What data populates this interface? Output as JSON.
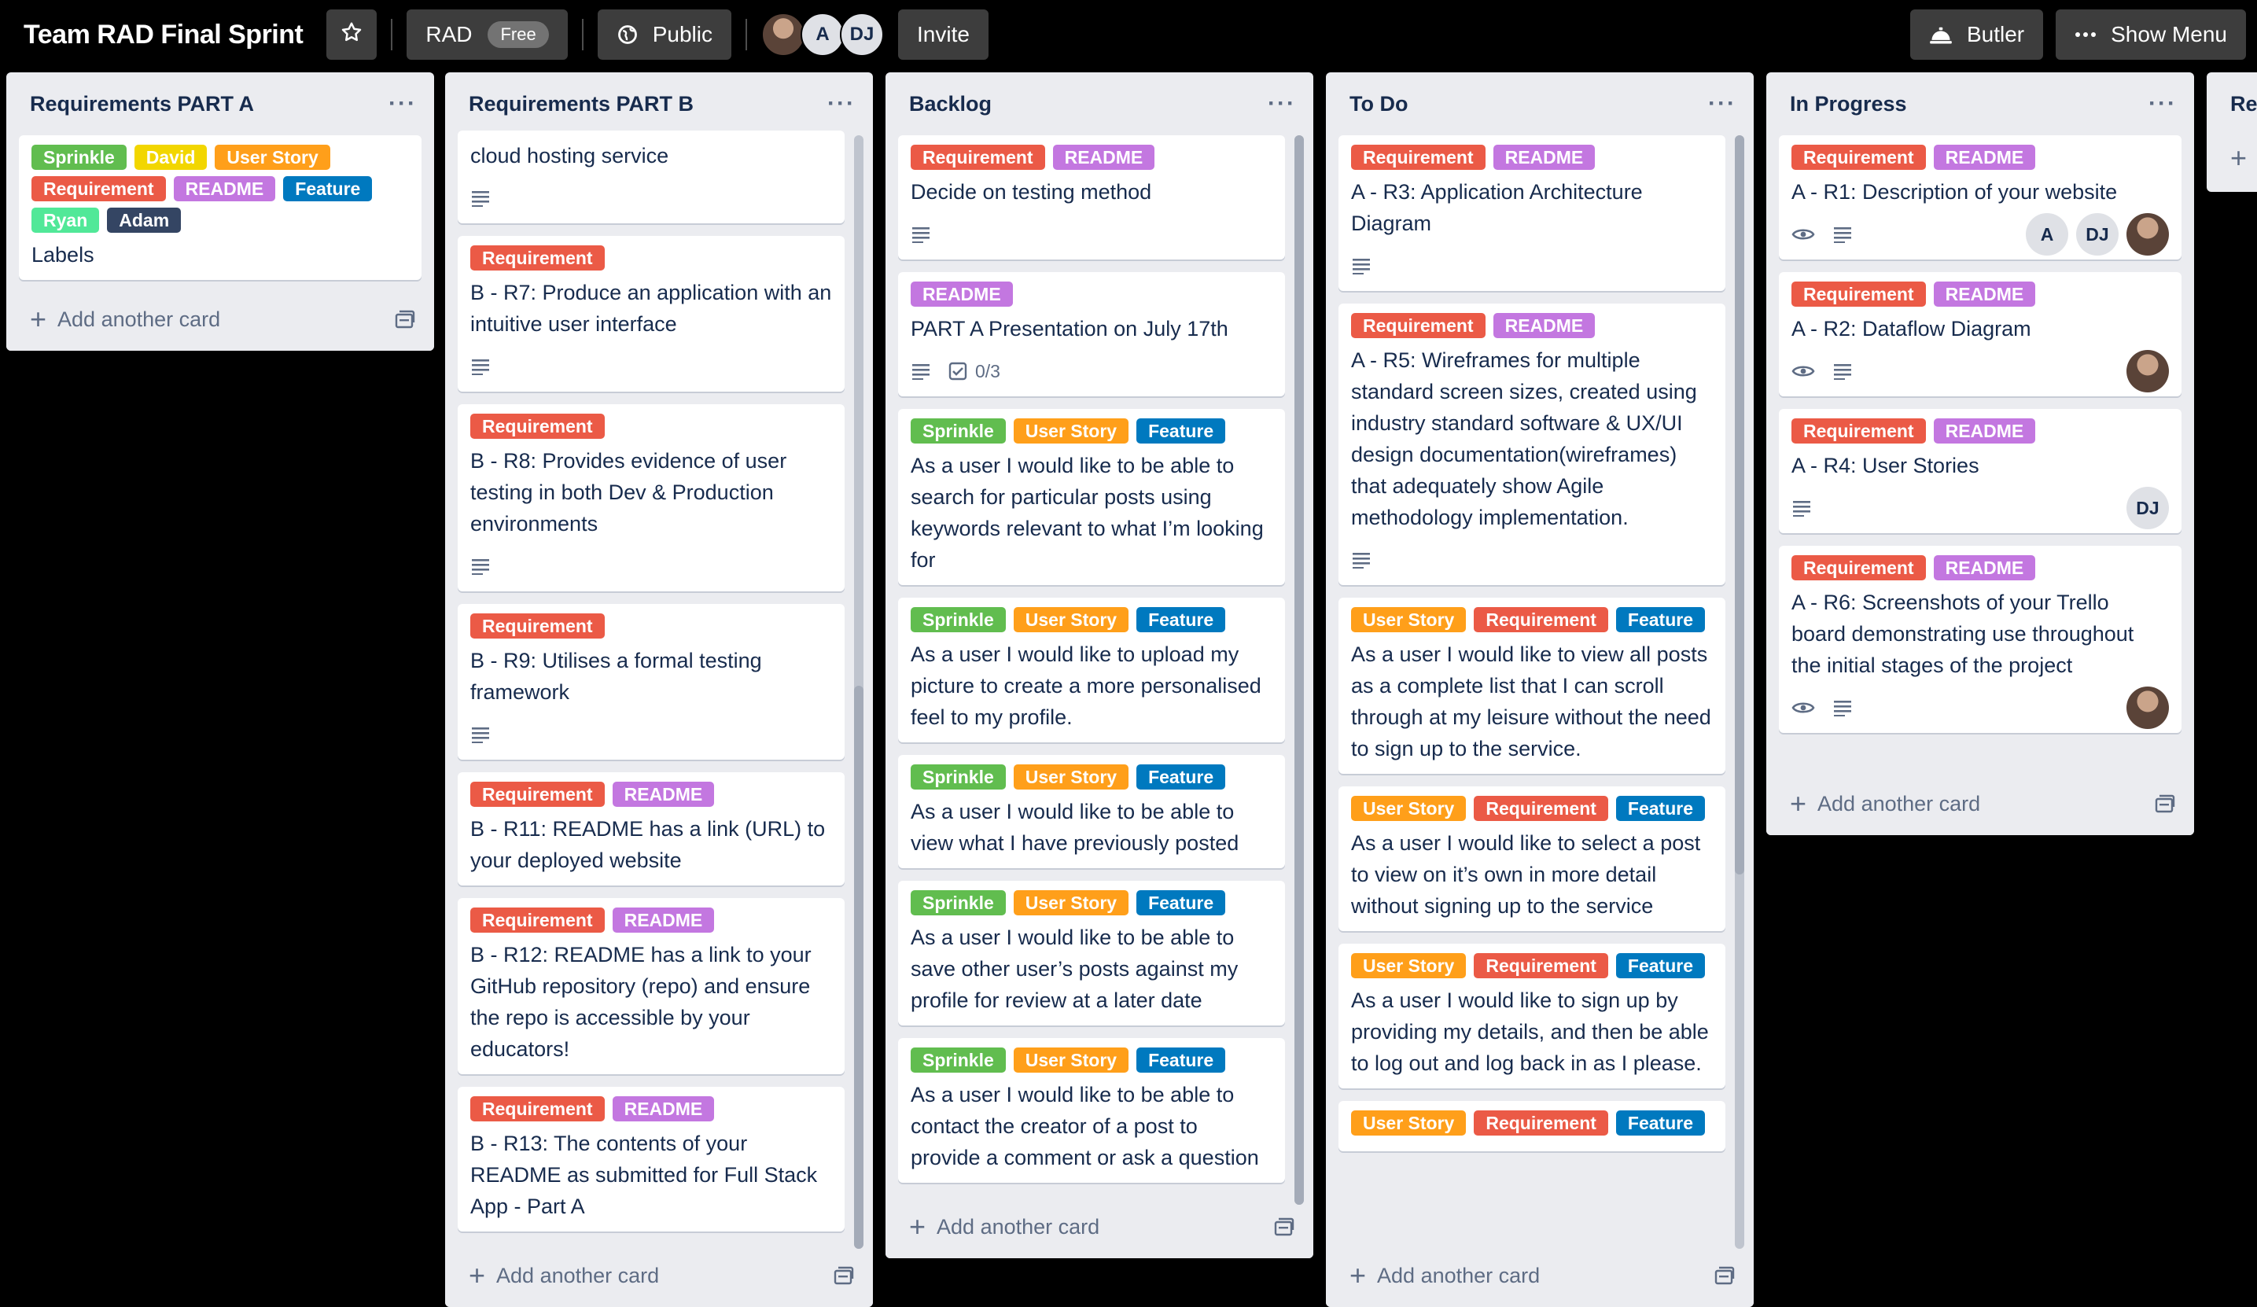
{
  "header": {
    "board_title": "Team RAD Final Sprint",
    "workspace": "RAD",
    "plan_badge": "Free",
    "visibility": "Public",
    "members": [
      "A",
      "DJ"
    ],
    "invite": "Invite",
    "butler": "Butler",
    "show_menu": "Show Menu"
  },
  "colors": {
    "Sprinkle": "#61bd4f",
    "David": "#f2d600",
    "User Story": "#ff9f1a",
    "Requirement": "#eb5a46",
    "README": "#c377e0",
    "Feature": "#0079bf",
    "Ryan": "#51e898",
    "Adam": "#344563"
  },
  "add_card_label": "Add another card",
  "lists": [
    {
      "title": "Requirements PART A",
      "cards": [
        {
          "labels": [
            "Sprinkle",
            "David",
            "User Story",
            "Requirement",
            "README",
            "Feature",
            "Ryan",
            "Adam"
          ],
          "title": "Labels"
        }
      ]
    },
    {
      "title": "Requirements PART B",
      "cards": [
        {
          "labels": [],
          "title": "cloud hosting service",
          "desc": true
        },
        {
          "labels": [
            "Requirement"
          ],
          "title": "B - R7: Produce an application with an intuitive user interface",
          "desc": true
        },
        {
          "labels": [
            "Requirement"
          ],
          "title": "B - R8: Provides evidence of user testing in both Dev & Production environments",
          "desc": true
        },
        {
          "labels": [
            "Requirement"
          ],
          "title": "B - R9: Utilises a formal testing framework",
          "desc": true
        },
        {
          "labels": [
            "Requirement",
            "README"
          ],
          "title": "B - R11: README has a link (URL) to your deployed website"
        },
        {
          "labels": [
            "Requirement",
            "README"
          ],
          "title": "B - R12: README has a link to your GitHub repository (repo) and ensure the repo is accessible by your educators!"
        },
        {
          "labels": [
            "Requirement",
            "README"
          ],
          "title": "B - R13: The contents of your README as submitted for Full Stack App - Part A"
        }
      ]
    },
    {
      "title": "Backlog",
      "cards": [
        {
          "labels": [
            "Requirement",
            "README"
          ],
          "title": "Decide on testing method",
          "desc": true
        },
        {
          "labels": [
            "README"
          ],
          "title": "PART A Presentation on July 17th",
          "desc": true,
          "checklist": "0/3"
        },
        {
          "labels": [
            "Sprinkle",
            "User Story",
            "Feature"
          ],
          "title": "As a user I would like to be able to search for particular posts using keywords relevant to what I’m looking for"
        },
        {
          "labels": [
            "Sprinkle",
            "User Story",
            "Feature"
          ],
          "title": "As a user I would like to upload my picture to create a more personalised feel to my profile."
        },
        {
          "labels": [
            "Sprinkle",
            "User Story",
            "Feature"
          ],
          "title": "As a user I would like to be able to view what I have previously posted"
        },
        {
          "labels": [
            "Sprinkle",
            "User Story",
            "Feature"
          ],
          "title": "As a user I would like to be able to save other user’s posts against my profile for review at a later date"
        },
        {
          "labels": [
            "Sprinkle",
            "User Story",
            "Feature"
          ],
          "title": "As a user I would like to be able to contact the creator of a post to provide a comment or ask a question"
        }
      ]
    },
    {
      "title": "To Do",
      "cards": [
        {
          "labels": [
            "Requirement",
            "README"
          ],
          "title": "A - R3: Application Architecture Diagram",
          "desc": true
        },
        {
          "labels": [
            "Requirement",
            "README"
          ],
          "title": "A - R5: Wireframes for multiple standard screen sizes, created using industry standard software & UX/UI design documentation(wireframes) that adequately show Agile methodology implementation.",
          "desc": true
        },
        {
          "labels": [
            "User Story",
            "Requirement",
            "Feature"
          ],
          "title": "As a user I would like to view all posts as a complete list that I can scroll through at my leisure without the need to sign up to the service."
        },
        {
          "labels": [
            "User Story",
            "Requirement",
            "Feature"
          ],
          "title": "As a user I would like to select a post to view on it’s own in more detail without signing up to the service"
        },
        {
          "labels": [
            "User Story",
            "Requirement",
            "Feature"
          ],
          "title": "As a user I would like to sign up by providing my details, and then be able to log out and log back in as I please."
        },
        {
          "labels": [
            "User Story",
            "Requirement",
            "Feature"
          ],
          "title": ""
        }
      ]
    },
    {
      "title": "In Progress",
      "cards": [
        {
          "labels": [
            "Requirement",
            "README"
          ],
          "title": "A - R1: Description of your website",
          "watch": true,
          "desc": true,
          "members": [
            "A",
            "DJ",
            "photo"
          ]
        },
        {
          "labels": [
            "Requirement",
            "README"
          ],
          "title": "A - R2: Dataflow Diagram",
          "watch": true,
          "desc": true,
          "members": [
            "photo"
          ]
        },
        {
          "labels": [
            "Requirement",
            "README"
          ],
          "title": "A - R4: User Stories",
          "desc": true,
          "members": [
            "DJ"
          ]
        },
        {
          "labels": [
            "Requirement",
            "README"
          ],
          "title": "A - R6: Screenshots of your Trello board demonstrating use throughout the initial stages of the project",
          "watch": true,
          "desc": true,
          "members": [
            "photo"
          ]
        }
      ]
    },
    {
      "title": "Re",
      "cards": []
    }
  ]
}
